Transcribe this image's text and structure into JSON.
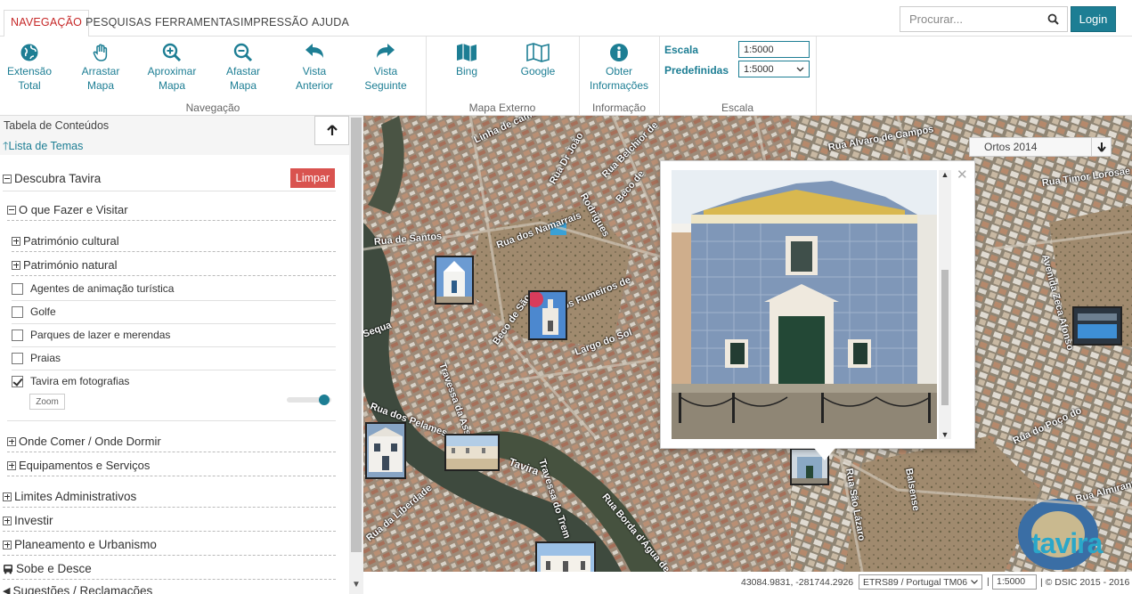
{
  "menu": {
    "tabs": [
      "NAVEGAÇÃO",
      "PESQUISAS",
      "FERRAMENTAS",
      "IMPRESSÃO",
      "AJUDA"
    ],
    "search_placeholder": "Procurar...",
    "login_label": "Login"
  },
  "ribbon": {
    "navigation": {
      "buttons": [
        {
          "line1": "Extensão",
          "line2": "Total"
        },
        {
          "line1": "Arrastar",
          "line2": "Mapa"
        },
        {
          "line1": "Aproximar",
          "line2": "Mapa"
        },
        {
          "line1": "Afastar",
          "line2": "Mapa"
        },
        {
          "line1": "Vista",
          "line2": "Anterior"
        },
        {
          "line1": "Vista",
          "line2": "Seguinte"
        }
      ],
      "group_label": "Navegação"
    },
    "external": {
      "buttons": [
        "Bing",
        "Google"
      ],
      "group_label": "Mapa Externo"
    },
    "info": {
      "line1": "Obter",
      "line2": "Informações",
      "group_label": "Informação"
    },
    "scale": {
      "scale_label": "Escala",
      "scale_value": "1:5000",
      "preset_label": "Predefinidas",
      "preset_value": "1:5000",
      "group_label": "Escala"
    }
  },
  "sidebar": {
    "toc_title": "Tabela de Conteúdos",
    "themes_link": "Lista de Temas",
    "section": "Descubra Tavira",
    "clear_label": "Limpar",
    "subsection": "O que Fazer e Visitar",
    "groups": [
      "Património cultural",
      "Património natural"
    ],
    "checkboxes": [
      {
        "label": "Agentes de animação turística",
        "checked": false
      },
      {
        "label": "Golfe",
        "checked": false
      },
      {
        "label": "Parques de lazer e merendas",
        "checked": false
      },
      {
        "label": "Praias",
        "checked": false
      },
      {
        "label": "Tavira em fotografias",
        "checked": true
      }
    ],
    "zoom_label": "Zoom",
    "opacity": 0.9,
    "more_subsections": [
      "Onde Comer / Onde Dormir",
      "Equipamentos e Serviços"
    ],
    "top_sections": [
      "Limites Administrativos",
      "Investir",
      "Planeamento e Urbanismo",
      "Sobe e Desce",
      "Sugestões / Reclamações"
    ]
  },
  "map": {
    "basemap_label": "Ortos 2014",
    "logo_text": "tavira",
    "streets": [
      "Linha de camin",
      "Rua Dr João",
      "Rodrigues",
      "Rua Belchior de",
      "Beco de",
      "Rua Alvaro de Campos",
      "Rua Timor Lorosae",
      "Rua dos Namarrais",
      "Rua dos Fumeiros de",
      "Rua dos Pelames",
      "Travessa da Assaca",
      "Tavira",
      "Travessa do Trem",
      "Rua Borda d'Água de Aguiar",
      "Rua da Liberdade",
      "Rua do Poço do",
      "Rua Almirant",
      "Avenida Zeca Afonso",
      "Largo do Sol",
      "Beco de São",
      "Rua de Santos",
      "Sequa",
      "Balsense",
      "Rua São Lázaro"
    ]
  },
  "status": {
    "coords": "43084.9831, -281744.2926",
    "crs": "ETRS89 / Portugal TM06",
    "scale": "1:5000",
    "copyright": "© DSIC 2015 - 2016"
  }
}
